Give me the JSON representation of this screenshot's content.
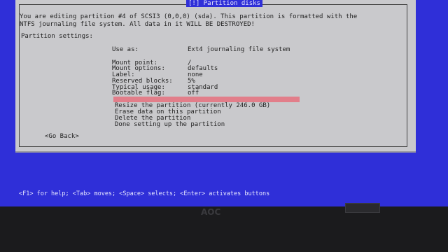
{
  "dialog": {
    "title": "[!] Partition disks",
    "warning_line1": "You are editing partition #4 of SCSI3 (0,0,0) (sda). This partition is formatted with the",
    "warning_line2": "NTFS journaling file system. All data in it WILL BE DESTROYED!",
    "settings_heading": "Partition settings:",
    "use_as_label": "Use as:",
    "use_as_value": "Ext4 journaling file system",
    "settings": [
      {
        "label": "Mount point:",
        "value": "/"
      },
      {
        "label": "Mount options:",
        "value": "defaults"
      },
      {
        "label": "Label:",
        "value": "none"
      },
      {
        "label": "Reserved blocks:",
        "value": "5%"
      },
      {
        "label": "Typical usage:",
        "value": "standard"
      },
      {
        "label": "Bootable flag:",
        "value": "off"
      }
    ],
    "actions": [
      "Resize the partition (currently 246.0 GB)",
      "Erase data on this partition",
      "Delete the partition",
      "Done setting up the partition"
    ],
    "go_back": "<Go Back>"
  },
  "help_bar": "<F1> for help; <Tab> moves; <Space> selects; <Enter> activates buttons",
  "monitor": {
    "brand": "AOC"
  },
  "colors": {
    "screen_bg": "#2f2fd8",
    "dialog_bg": "#c9c9cc",
    "selection": "#e27e8a"
  }
}
